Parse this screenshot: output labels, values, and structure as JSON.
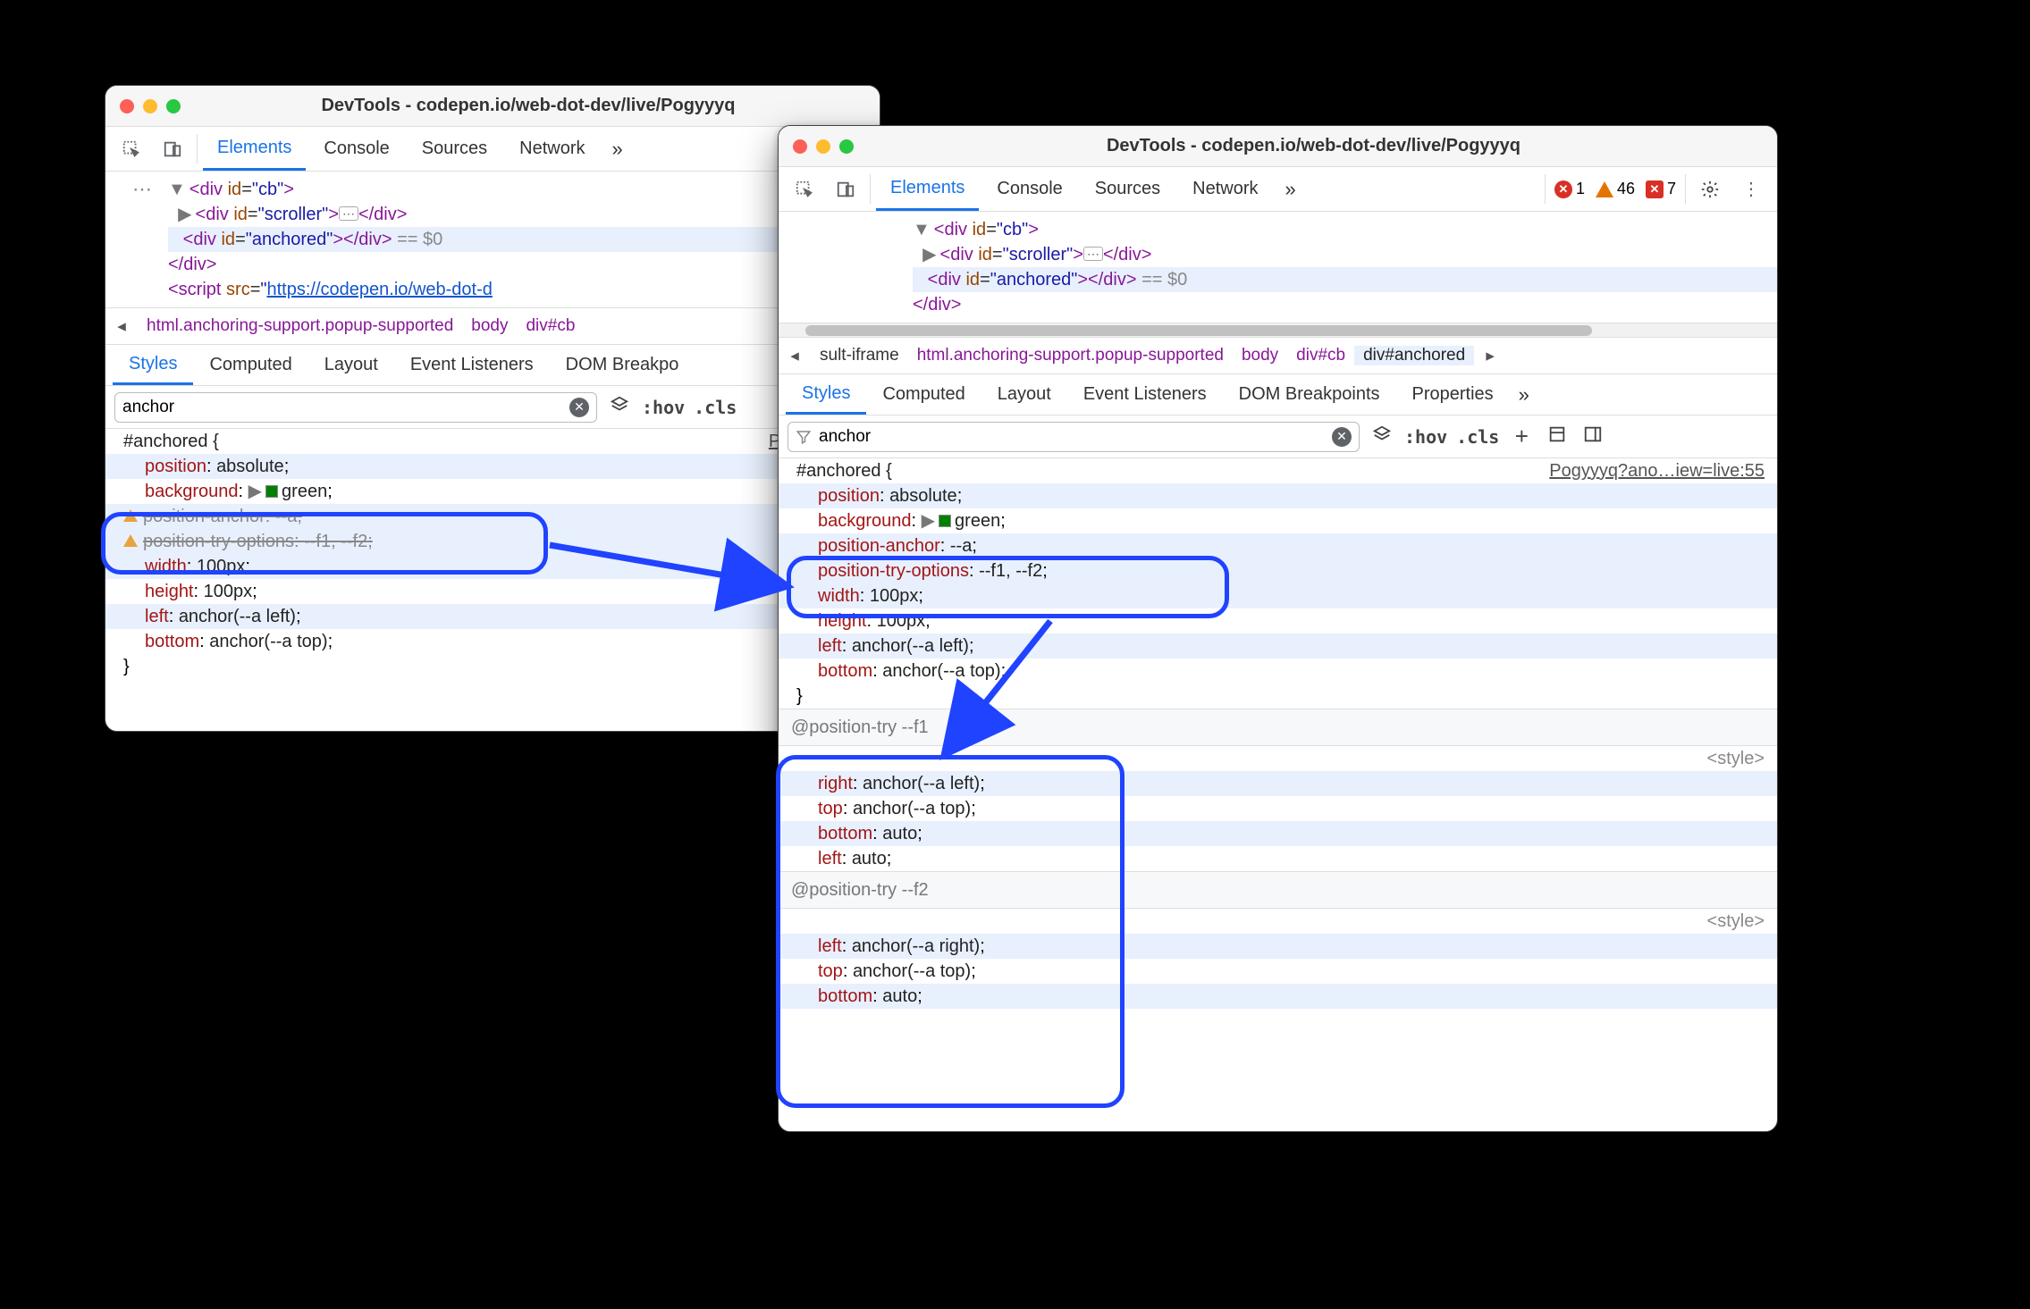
{
  "windowA": {
    "title": "DevTools - codepen.io/web-dot-dev/live/Pogyyyq",
    "mainTabs": [
      "Elements",
      "Console",
      "Sources",
      "Network"
    ],
    "activeMainTab": 0,
    "elements": {
      "rows": [
        {
          "indent": 0,
          "tri": "▼",
          "html": "<div id=\"cb\">"
        },
        {
          "indent": 1,
          "tri": "▶",
          "html": "<div id=\"scroller\">…</div>",
          "dots": true
        },
        {
          "indent": 1,
          "tri": "",
          "html": "<div id=\"anchored\"></div> == $0",
          "hl": true
        },
        {
          "indent": 0,
          "tri": "",
          "html": "</div>"
        },
        {
          "indent": 0,
          "tri": "",
          "html": "<script src=\"https://codepen.io/web-dot-d"
        }
      ]
    },
    "crumbs": [
      "html.anchoring-support.popup-supported",
      "body",
      "div#cb"
    ],
    "subTabs": [
      "Styles",
      "Computed",
      "Layout",
      "Event Listeners",
      "DOM Breakpo"
    ],
    "activeSubTab": 0,
    "filter": "anchor",
    "tool_hov": ":hov",
    "tool_cls": ".cls",
    "ruleLink": "Pogyyyq?an",
    "css": {
      "selector": "#anchored {",
      "decls": [
        {
          "p": "position",
          "v": "absolute",
          "s": false,
          "w": false
        },
        {
          "p": "background",
          "v": "green",
          "s": false,
          "w": false,
          "swatch": true,
          "tri": true
        },
        {
          "p": "position-anchor",
          "v": "--a",
          "s": true,
          "w": true
        },
        {
          "p": "position-try-options",
          "v": "--f1, --f2",
          "s": true,
          "w": true
        },
        {
          "p": "width",
          "v": "100px",
          "s": false,
          "w": false
        },
        {
          "p": "height",
          "v": "100px",
          "s": false,
          "w": false
        },
        {
          "p": "left",
          "v": "anchor(--a left)",
          "s": false,
          "w": false
        },
        {
          "p": "bottom",
          "v": "anchor(--a top)",
          "s": false,
          "w": false
        }
      ],
      "close": "}"
    }
  },
  "windowB": {
    "title": "DevTools - codepen.io/web-dot-dev/live/Pogyyyq",
    "mainTabs": [
      "Elements",
      "Console",
      "Sources",
      "Network"
    ],
    "activeMainTab": 0,
    "errCount": "1",
    "warnCount": "46",
    "msgCount": "7",
    "elements": {
      "rows": [
        {
          "indent": 0,
          "tri": "▼",
          "html": "<div id=\"cb\">"
        },
        {
          "indent": 1,
          "tri": "▶",
          "html": "<div id=\"scroller\">…</div>",
          "dots": true
        },
        {
          "indent": 1,
          "tri": "",
          "html": "<div id=\"anchored\"></div> == $0",
          "hl": true
        },
        {
          "indent": 0,
          "tri": "",
          "html": "</div>"
        }
      ]
    },
    "crumbs": [
      "sult-iframe",
      "html.anchoring-support.popup-supported",
      "body",
      "div#cb",
      "div#anchored"
    ],
    "selectedCrumb": 4,
    "subTabs": [
      "Styles",
      "Computed",
      "Layout",
      "Event Listeners",
      "DOM Breakpoints",
      "Properties"
    ],
    "activeSubTab": 0,
    "filter": "anchor",
    "tool_hov": ":hov",
    "tool_cls": ".cls",
    "ruleLink": "Pogyyyq?ano…iew=live:55",
    "css": {
      "selector": "#anchored {",
      "decls": [
        {
          "p": "position",
          "v": "absolute"
        },
        {
          "p": "background",
          "v": "green",
          "swatch": true,
          "tri": true
        },
        {
          "p": "position-anchor",
          "v": "--a"
        },
        {
          "p": "position-try-options",
          "v": "--f1, --f2"
        },
        {
          "p": "width",
          "v": "100px"
        },
        {
          "p": "height",
          "v": "100px"
        },
        {
          "p": "left",
          "v": "anchor(--a left)"
        },
        {
          "p": "bottom",
          "v": "anchor(--a top)"
        }
      ],
      "close": "}"
    },
    "try1": {
      "header": "@position-try --f1",
      "link": "<style>",
      "decls": [
        {
          "p": "right",
          "v": "anchor(--a left)"
        },
        {
          "p": "top",
          "v": "anchor(--a top)"
        },
        {
          "p": "bottom",
          "v": "auto"
        },
        {
          "p": "left",
          "v": "auto"
        }
      ]
    },
    "try2": {
      "header": "@position-try --f2",
      "link": "<style>",
      "decls": [
        {
          "p": "left",
          "v": "anchor(--a right)"
        },
        {
          "p": "top",
          "v": "anchor(--a top)"
        },
        {
          "p": "bottom",
          "v": "auto"
        }
      ]
    }
  }
}
